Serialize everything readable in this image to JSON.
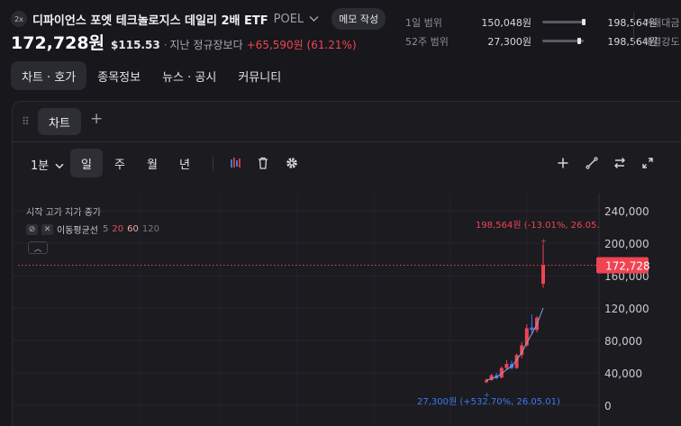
{
  "header": {
    "logo_text": "2x",
    "name": "디파이언스 포엣 테크놀로지스 데일리 2배 ETF",
    "ticker": "POEL",
    "memo_button": "메모 작성",
    "price": "172,728원",
    "price_usd": "$115.53",
    "separator": "·",
    "session": "지난 정규장보다",
    "change": "+65,590원 (61.21%)"
  },
  "ranges": [
    {
      "label": "1일 범위",
      "low": "150,048원",
      "high": "198,564원",
      "position": 0.95
    },
    {
      "label": "52주 범위",
      "low": "27,300원",
      "high": "198,564원",
      "position": 0.85
    }
  ],
  "range_extra": [
    "거래대금",
    "체결강도"
  ],
  "tabs": [
    "차트 · 호가",
    "종목정보",
    "뉴스 · 공시",
    "커뮤니티"
  ],
  "chart_panel": {
    "tab_label": "차트",
    "add_label": "+",
    "interval": "1분",
    "periods": [
      "일",
      "주",
      "월",
      "년"
    ],
    "active_period": "일",
    "legend": "시작 고가 저가 종가",
    "ma_label": "이동평균선",
    "ma_periods": [
      "5",
      "20",
      "60",
      "120"
    ],
    "current_price_label": "172,728",
    "high_annotation": "198,564원 (-13.01%, 26.05.",
    "low_annotation": "27,300원 (+532.70%, 26.05.01)"
  },
  "colors": {
    "up": "#f04452",
    "down": "#3d7bf2",
    "ma5": "#8aa4d6",
    "background": "#1b1b20"
  },
  "chart_data": {
    "type": "candlestick",
    "ylim": [
      0,
      240000
    ],
    "yticks": [
      "240,000",
      "200,000",
      "160,000",
      "120,000",
      "80,000",
      "40,000",
      "0"
    ],
    "candles": [
      {
        "open": 28500,
        "high": 33000,
        "low": 27300,
        "close": 31000
      },
      {
        "open": 31000,
        "high": 39000,
        "low": 30500,
        "close": 37000
      },
      {
        "open": 37000,
        "high": 40000,
        "low": 32000,
        "close": 33500
      },
      {
        "open": 34000,
        "high": 48000,
        "low": 33500,
        "close": 46000
      },
      {
        "open": 46000,
        "high": 56000,
        "low": 44000,
        "close": 51000
      },
      {
        "open": 51000,
        "high": 55000,
        "low": 44000,
        "close": 46000
      },
      {
        "open": 46000,
        "high": 64000,
        "low": 45000,
        "close": 62000
      },
      {
        "open": 62000,
        "high": 78000,
        "low": 58000,
        "close": 74000
      },
      {
        "open": 74000,
        "high": 100000,
        "low": 72000,
        "close": 95000
      },
      {
        "open": 96000,
        "high": 112000,
        "low": 89000,
        "close": 93000
      },
      {
        "open": 93000,
        "high": 110000,
        "low": 90000,
        "close": 108000
      },
      {
        "open": 150000,
        "high": 198564,
        "low": 145000,
        "close": 172728
      }
    ],
    "ma5": [
      31000,
      33000,
      35000,
      39000,
      44000,
      48000,
      56000,
      65000,
      77000,
      88000,
      100000,
      120000
    ]
  }
}
